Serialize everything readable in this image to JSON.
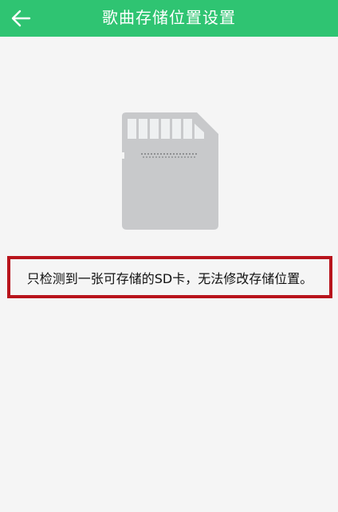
{
  "header": {
    "title": "歌曲存储位置设置",
    "back_icon": "arrow-left-icon",
    "background_color": "#2fc472"
  },
  "main": {
    "illustration_icon": "sd-card-icon",
    "message": "只检测到一张可存储的SD卡，无法修改存储位置。",
    "highlight_color": "#b8141c"
  }
}
